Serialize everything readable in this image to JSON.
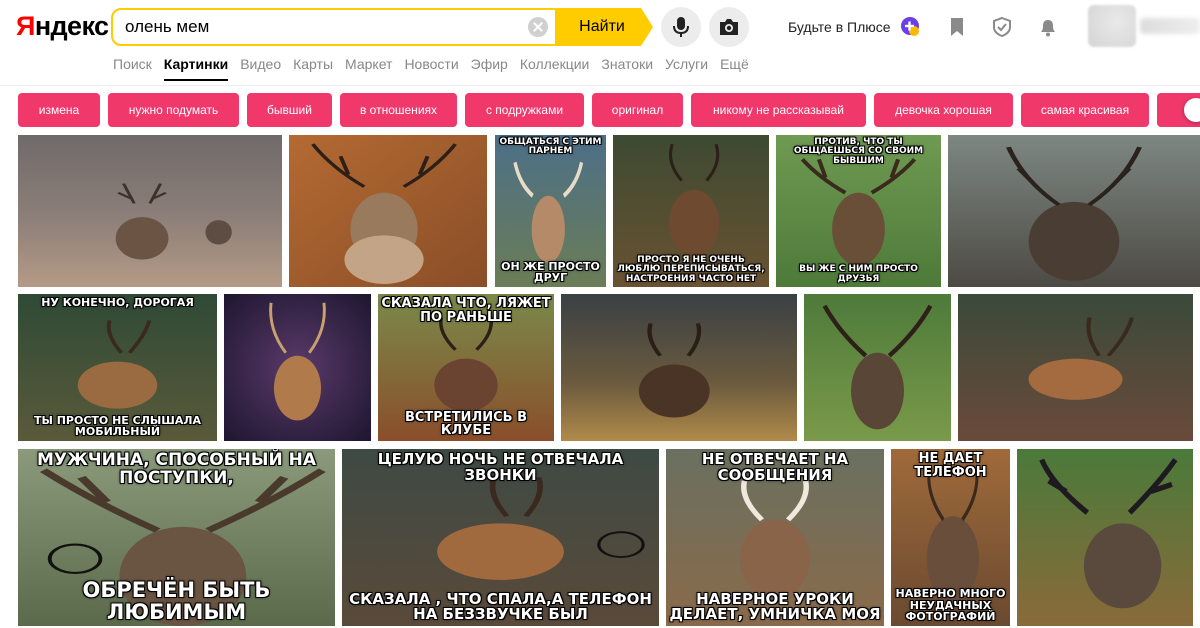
{
  "logo": {
    "first": "Я",
    "rest": "ндекс"
  },
  "search": {
    "value": "олень мем",
    "button": "Найти"
  },
  "header": {
    "plus_link": "Будьте в Плюсе"
  },
  "nav": [
    "Поиск",
    "Картинки",
    "Видео",
    "Карты",
    "Маркет",
    "Новости",
    "Эфир",
    "Коллекции",
    "Знатоки",
    "Услуги",
    "Ещё"
  ],
  "tags": [
    "измена",
    "нужно подумать",
    "бывший",
    "в отношениях",
    "с подружками",
    "оригинал",
    "никому не рассказывай",
    "девочка хорошая",
    "самая красивая"
  ],
  "images": [
    {
      "top": "",
      "bottom": ""
    },
    {
      "top": "",
      "bottom": ""
    },
    {
      "top": "общаться с этим парнем",
      "bottom": "он же просто друг"
    },
    {
      "top": "",
      "bottom": "просто я не очень люблю переписываться, настроения часто нет"
    },
    {
      "top": "против, что ты общаешься со своим бывшим",
      "bottom": "вы же с ним просто друзья"
    },
    {
      "top": "",
      "bottom": ""
    },
    {
      "top": "ну конечно, дорогая",
      "bottom": "ты просто не слышала мобильный"
    },
    {
      "top": "",
      "bottom": ""
    },
    {
      "top": "сказала что, ляжет по раньше",
      "bottom": "встретились в клубе"
    },
    {
      "top": "",
      "bottom": ""
    },
    {
      "top": "",
      "bottom": ""
    },
    {
      "top": "",
      "bottom": ""
    },
    {
      "top": "мужчина, способный на поступки,",
      "bottom": "обречён быть любимым"
    },
    {
      "top": "целую ночь не отвечала звонки",
      "bottom": "сказала , что спала,а телефон на беззвучке был"
    },
    {
      "top": "не отвечает на сообщения",
      "bottom": "наверное уроки делает, умничка моя"
    },
    {
      "top": "не дает телефон",
      "bottom": "наверно много неудачных фотографий"
    },
    {
      "top": "",
      "bottom": ""
    }
  ]
}
